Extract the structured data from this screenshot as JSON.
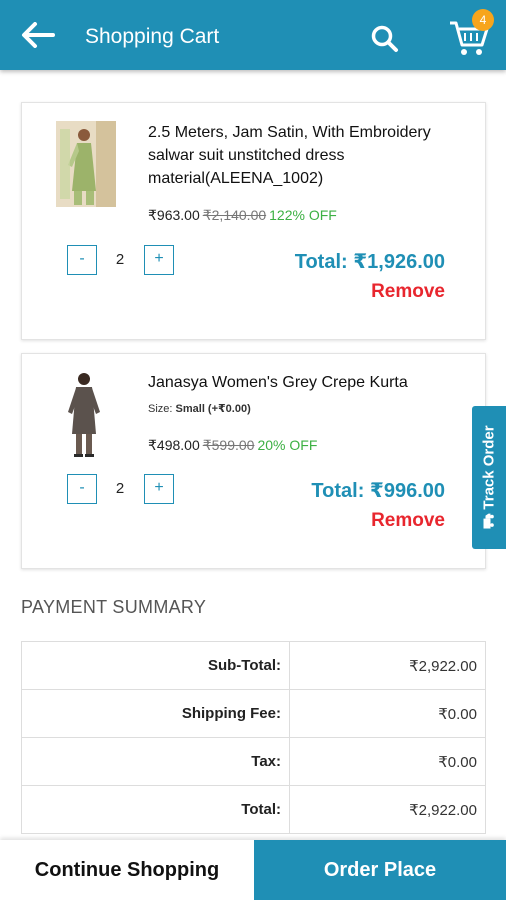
{
  "header": {
    "title": "Shopping Cart",
    "back_icon": "arrow-left-icon",
    "search_icon": "search-icon",
    "cart_icon": "cart-icon",
    "cart_count": "4"
  },
  "cart_items": [
    {
      "name": "2.5 Meters, Jam Satin, With Embroidery salwar suit unstitched dress material(ALEENA_1002)",
      "price": "₹963.00",
      "mrp": "₹2,140.00",
      "discount": "122% OFF",
      "qty_minus": "-",
      "qty": "2",
      "qty_plus": "+",
      "total": "Total: ₹1,926.00",
      "remove": "Remove"
    },
    {
      "name": "Janasya Women's Grey Crepe Kurta",
      "size_label": "Size:",
      "size_value": "Small (+₹0.00)",
      "price": "₹498.00",
      "mrp": "₹599.00",
      "discount": "20% OFF",
      "qty_minus": "-",
      "qty": "2",
      "qty_plus": "+",
      "total": "Total: ₹996.00",
      "remove": "Remove"
    }
  ],
  "payment_summary": {
    "title": "PAYMENT SUMMARY",
    "rows": [
      {
        "label": "Sub-Total:",
        "value": "₹2,922.00"
      },
      {
        "label": "Shipping Fee:",
        "value": "₹0.00"
      },
      {
        "label": "Tax:",
        "value": "₹0.00"
      },
      {
        "label": "Total:",
        "value": "₹2,922.00"
      }
    ]
  },
  "track_order": {
    "label": "Track Order",
    "icon": "truck-icon"
  },
  "footer": {
    "continue_label": "Continue Shopping",
    "order_label": "Order Place"
  },
  "colors": {
    "primary": "#1f8fb5",
    "badge": "#f7a51c",
    "remove": "#e8262e",
    "discount": "#3cb043"
  }
}
